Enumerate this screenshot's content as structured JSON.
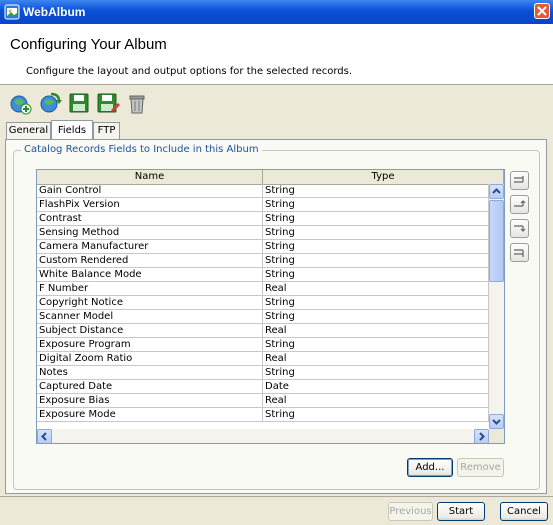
{
  "window": {
    "title": "WebAlbum"
  },
  "header": {
    "title": "Configuring Your Album",
    "subtitle": "Configure the layout and output options for the selected records."
  },
  "toolbar": {
    "icons": [
      "add-page-icon",
      "refresh-globe-icon",
      "save-icon",
      "save-as-icon",
      "trash-icon"
    ]
  },
  "tabs": [
    {
      "label": "General"
    },
    {
      "label": "Fields",
      "selected": true
    },
    {
      "label": "FTP"
    }
  ],
  "group": {
    "title": "Catalog Records Fields to Include in this Album"
  },
  "table": {
    "columns": [
      "Name",
      "Type"
    ],
    "rows": [
      [
        "Gain Control",
        "String"
      ],
      [
        "FlashPix Version",
        "String"
      ],
      [
        "Contrast",
        "String"
      ],
      [
        "Sensing Method",
        "String"
      ],
      [
        "Camera Manufacturer",
        "String"
      ],
      [
        "Custom Rendered",
        "String"
      ],
      [
        "White Balance Mode",
        "String"
      ],
      [
        "F Number",
        "Real"
      ],
      [
        "Copyright Notice",
        "String"
      ],
      [
        "Scanner Model",
        "String"
      ],
      [
        "Subject Distance",
        "Real"
      ],
      [
        "Exposure Program",
        "String"
      ],
      [
        "Digital Zoom Ratio",
        "Real"
      ],
      [
        "Notes",
        "String"
      ],
      [
        "Captured Date",
        "Date"
      ],
      [
        "Exposure Bias",
        "Real"
      ],
      [
        "Exposure Mode",
        "String"
      ]
    ]
  },
  "side_buttons": [
    "move-top-icon",
    "move-up-icon",
    "move-down-icon",
    "move-bottom-icon"
  ],
  "buttons": {
    "add": "Add...",
    "remove": "Remove",
    "previous": "Previous",
    "start": "Start",
    "cancel": "Cancel"
  },
  "colors": {
    "title_bar": "#0a50d8",
    "group_title": "#1f4f9e",
    "scroll": "#b5cdf7"
  }
}
